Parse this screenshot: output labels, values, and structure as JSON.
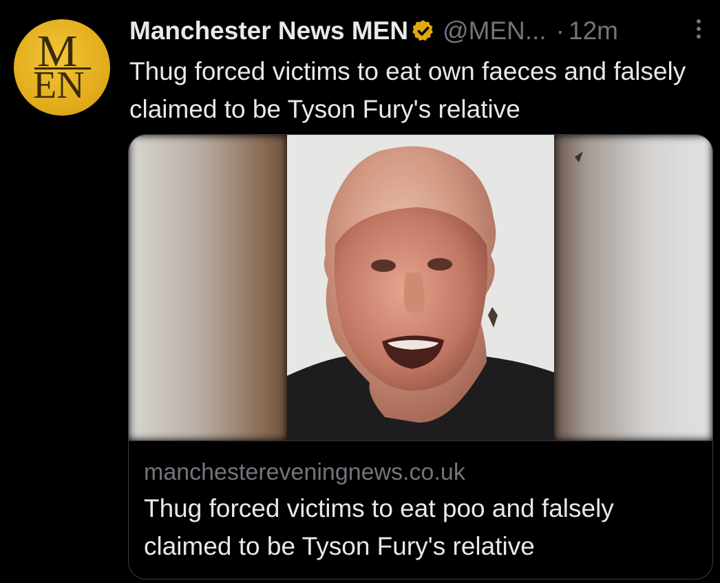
{
  "tweet": {
    "avatar": {
      "line1": "M",
      "line2": "EN"
    },
    "author_name": "Manchester News MEN",
    "handle": "@MEN...",
    "separator": "·",
    "timestamp": "12m",
    "text": "Thug forced victims to eat own faeces and falsely claimed to be Tyson Fury's relative",
    "icons": {
      "verified": "verified-badge-icon",
      "more": "more-options-icon"
    },
    "colors": {
      "background": "#000000",
      "text": "#e7e9ea",
      "secondary": "#71767b",
      "verified_badge": "#e3a712",
      "avatar": "#e3ad1d",
      "card_border": "#3a3f44"
    }
  },
  "link_card": {
    "domain": "manchestereveningnews.co.uk",
    "title": "Thug forced victims to eat poo and falsely claimed to be Tyson Fury's relative"
  }
}
